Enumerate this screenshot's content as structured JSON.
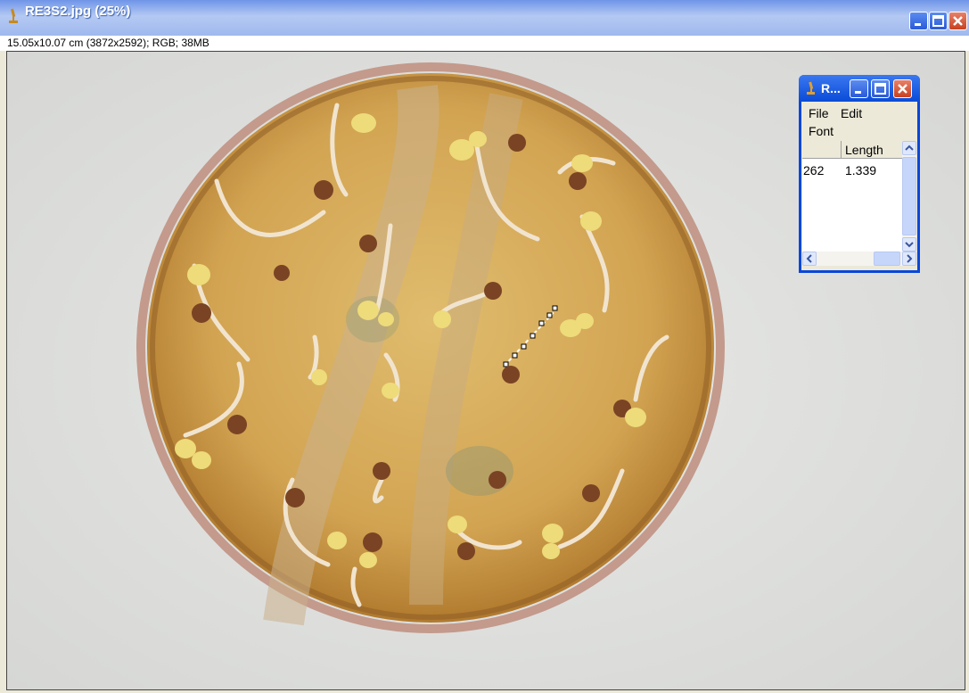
{
  "window": {
    "title": "RE3S2.jpg (25%)",
    "info": "15.05x10.07 cm (3872x2592); RGB; 38MB",
    "icon": "microscope-icon"
  },
  "results": {
    "title": "R...",
    "menu": [
      "File",
      "Edit",
      "Font"
    ],
    "columns": [
      "",
      "Length"
    ],
    "rows": [
      {
        "index": "262",
        "length": "1.339"
      }
    ]
  },
  "colors": {
    "titlebar": "#9fb9ee",
    "results_titlebar": "#0a4bd8",
    "agar": "#d2a85a",
    "dish_rim": "#b58a7d",
    "background": "#e3e4e2"
  }
}
